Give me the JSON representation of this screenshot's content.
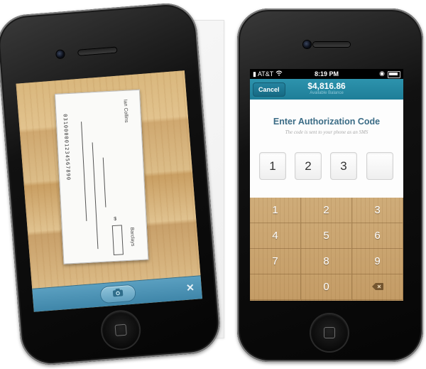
{
  "left_phone": {
    "check": {
      "name": "Ian Collins",
      "bank": "Barclays",
      "routing": "031000001234567890",
      "dollar_sign": "$"
    },
    "icons": {
      "camera": "camera-icon",
      "close": "close-icon"
    },
    "close_label": "✕"
  },
  "right_phone": {
    "status_bar": {
      "carrier": "AT&T",
      "time": "8:19 PM"
    },
    "nav": {
      "cancel_label": "Cancel",
      "amount": "$4,816.86",
      "amount_sub": "Available Balance"
    },
    "auth": {
      "title": "Enter Authorization Code",
      "subtitle": "The code is sent to your phone as an SMS",
      "digits": [
        "1",
        "2",
        "3",
        ""
      ]
    },
    "keypad": {
      "keys": [
        "1",
        "2",
        "3",
        "4",
        "5",
        "6",
        "7",
        "8",
        "9",
        "",
        "0",
        "backspace"
      ],
      "backspace_icon": "backspace-icon"
    }
  },
  "colors": {
    "accent": "#1e7e98",
    "title": "#3a6b85",
    "wood": "#c9a574"
  }
}
